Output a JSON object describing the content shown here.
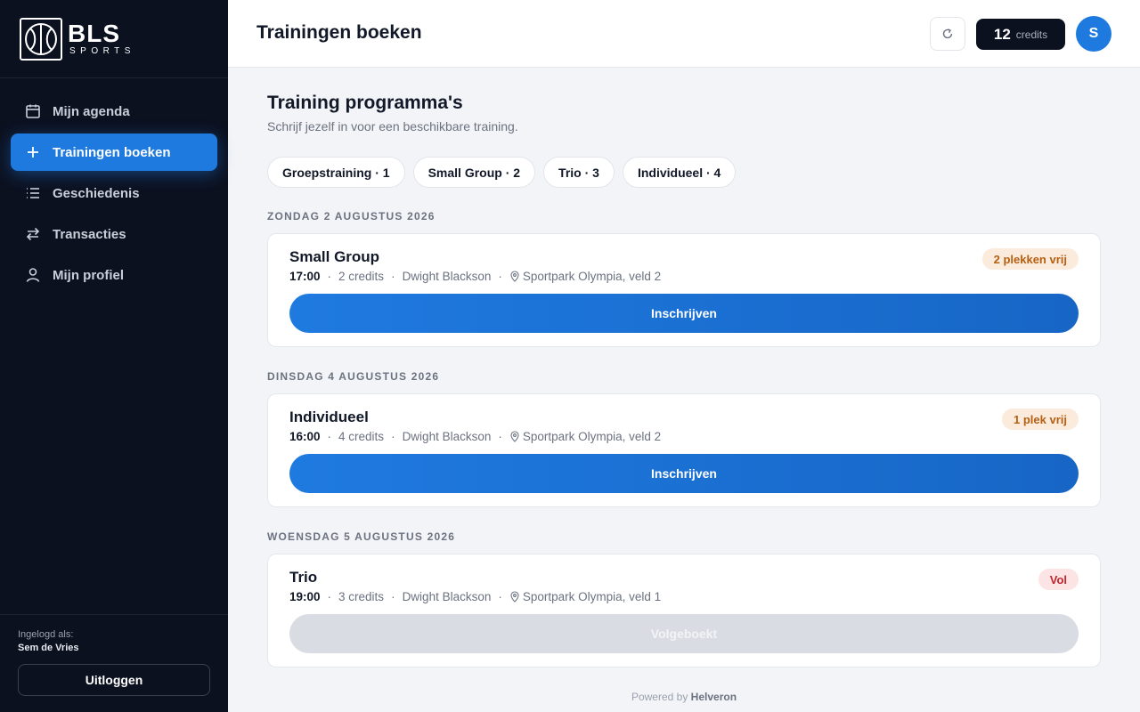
{
  "brand": {
    "name": "BLS",
    "tagline": "SPORTS"
  },
  "sidebar": {
    "items": [
      {
        "label": "Mijn agenda",
        "icon": "calendar-icon",
        "active": false
      },
      {
        "label": "Trainingen boeken",
        "icon": "plus-icon",
        "active": true
      },
      {
        "label": "Geschiedenis",
        "icon": "list-icon",
        "active": false
      },
      {
        "label": "Transacties",
        "icon": "arrows-swap-icon",
        "active": false
      },
      {
        "label": "Mijn profiel",
        "icon": "user-icon",
        "active": false
      }
    ],
    "logged_in_label": "Ingelogd als:",
    "user_name": "Sem de Vries",
    "logout_label": "Uitloggen"
  },
  "header": {
    "title": "Trainingen boeken",
    "credits_count": "12",
    "credits_label": "credits",
    "avatar_initial": "S"
  },
  "main": {
    "title": "Training programma's",
    "subtitle": "Schrijf jezelf in voor een beschikbare training.",
    "filters": [
      {
        "label": "Groepstraining · 1"
      },
      {
        "label": "Small Group · 2"
      },
      {
        "label": "Trio · 3"
      },
      {
        "label": "Individueel · 4"
      }
    ],
    "days": [
      {
        "date_label": "ZONDAG 2 AUGUSTUS 2026",
        "session": {
          "title": "Small Group",
          "time": "17:00",
          "credits": "2 credits",
          "trainer": "Dwight Blackson",
          "location": "Sportpark Olympia, veld 2",
          "badge": "2 plekken vrij",
          "button": "Inschrijven"
        }
      },
      {
        "date_label": "DINSDAG 4 AUGUSTUS 2026",
        "session": {
          "title": "Individueel",
          "time": "16:00",
          "credits": "4 credits",
          "trainer": "Dwight Blackson",
          "location": "Sportpark Olympia, veld 2",
          "badge": "1 plek vrij",
          "button": "Inschrijven"
        }
      },
      {
        "date_label": "WOENSDAG 5 AUGUSTUS 2026",
        "session": {
          "title": "Trio",
          "time": "19:00",
          "credits": "3 credits",
          "trainer": "Dwight Blackson",
          "location": "Sportpark Olympia, veld 1",
          "badge": "Vol",
          "button": "Volgeboekt"
        }
      }
    ],
    "meta_separator": "·"
  },
  "footer": {
    "prefix": "Powered by",
    "brand": "Helveron"
  },
  "colors": {
    "accent": "#1f7ae0",
    "sidebar_bg": "#0c1120",
    "badge_available_bg": "#fbebdc",
    "badge_available_text": "#b45f12",
    "badge_full_bg": "#fde4e4",
    "badge_full_text": "#c0262d"
  }
}
